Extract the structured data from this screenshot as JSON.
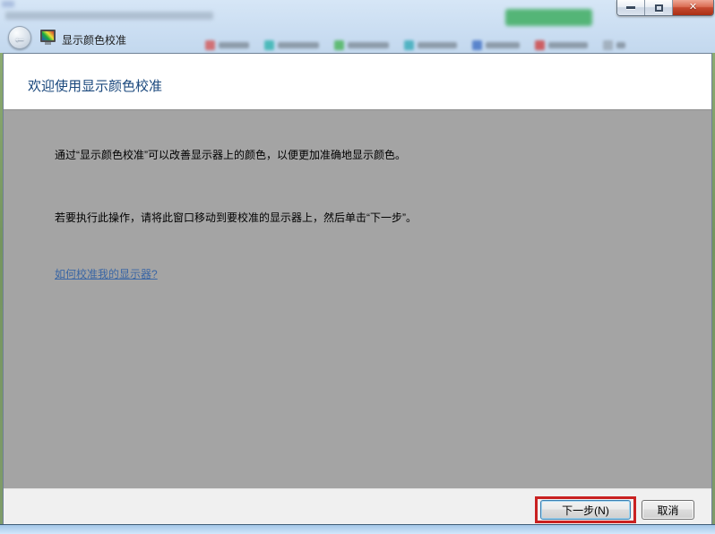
{
  "browser": {
    "tab_title_blurred": true,
    "badge_color": "#3fae62",
    "bookmarks": [
      {
        "icon_color": "#d45757",
        "label_width": 34
      },
      {
        "icon_color": "#2fb3ae",
        "label_width": 46
      },
      {
        "icon_color": "#47b457",
        "label_width": 46
      },
      {
        "icon_color": "#35aab8",
        "label_width": 44
      },
      {
        "icon_color": "#3f6fc4",
        "label_width": 38
      },
      {
        "icon_color": "#cf4040",
        "label_width": 44
      },
      {
        "icon_color": "#9aa7b4",
        "label_width": 10
      }
    ]
  },
  "window_controls": {
    "close_glyph": "✕"
  },
  "wizard": {
    "back_glyph": "←",
    "caption_title": "显示颜色校准",
    "heading": "欢迎使用显示颜色校准",
    "paragraph1": "通过“显示颜色校准”可以改善显示器上的颜色，以便更加准确地显示颜色。",
    "paragraph2": "若要执行此操作，请将此窗口移动到要校准的显示器上，然后单击“下一步”。",
    "help_link": "如何校准我的显示器?",
    "next_button": "下一步(N)",
    "cancel_button": "取消"
  },
  "annotation": {
    "highlight_color": "#c92121",
    "target": "next-button"
  },
  "colors": {
    "titlebar": "#c9ddf1",
    "wizard_body_gray": "#a4a4a4",
    "heading_blue": "#19477c",
    "link_blue": "#3a66a5",
    "footer_gray": "#f0f0f0",
    "close_button_red": "#c64a30",
    "default_button_border": "#3c7fb1"
  }
}
